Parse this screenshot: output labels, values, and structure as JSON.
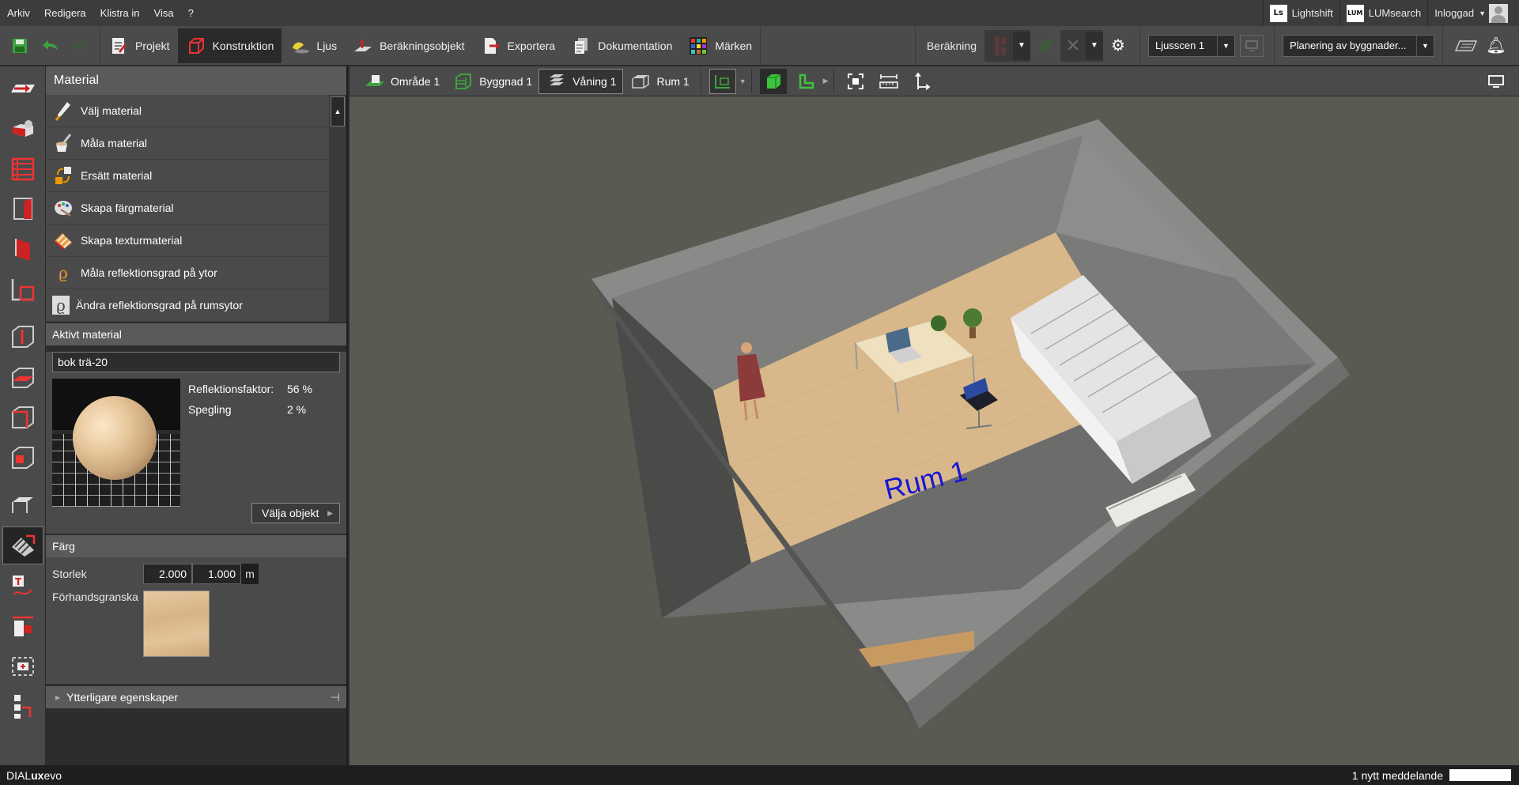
{
  "menu": [
    "Arkiv",
    "Redigera",
    "Klistra in",
    "Visa",
    "?"
  ],
  "topright": {
    "lightshift_logo": "Ls",
    "lightshift": "Lightshift",
    "lumsearch_logo": "LUM",
    "lumsearch": "LUMsearch",
    "user": "Inloggad"
  },
  "toolbar": {
    "tabs": [
      "Projekt",
      "Konstruktion",
      "Ljus",
      "Beräkningsobjekt",
      "Exportera",
      "Dokumentation",
      "Märken"
    ],
    "active_tab": "Konstruktion",
    "berakning": "Beräkning",
    "scene_select": "Ljusscen 1",
    "planning_select": "Planering av byggnader..."
  },
  "panel": {
    "title": "Material",
    "tools": [
      {
        "label": "Välj material",
        "icon": "pipette-icon"
      },
      {
        "label": "Måla material",
        "icon": "paint-bucket-icon"
      },
      {
        "label": "Ersätt material",
        "icon": "replace-icon"
      },
      {
        "label": "Skapa färgmaterial",
        "icon": "palette-icon"
      },
      {
        "label": "Skapa texturmaterial",
        "icon": "texture-icon"
      },
      {
        "label": "Måla reflektionsgrad på ytor",
        "icon": "rho-orange-icon"
      },
      {
        "label": "Ändra reflektionsgrad på rumsytor",
        "icon": "rho-gray-icon"
      }
    ],
    "active_material_title": "Aktivt material",
    "active_material_name": "bok trä-20",
    "reflection_label": "Reflektionsfaktor:",
    "reflection_value": "56 %",
    "specular_label": "Spegling",
    "specular_value": "2 %",
    "select_objects": "Välja objekt",
    "color_title": "Färg",
    "size_label": "Storlek",
    "size_w": "2.000",
    "size_h": "1.000",
    "size_unit": "m",
    "preview_label": "Förhandsgranska",
    "more_props": "Ytterligare egenskaper"
  },
  "viewbar": {
    "crumbs": [
      "Område 1",
      "Byggnad 1",
      "Våning 1",
      "Rum 1"
    ],
    "active_crumb": "Våning 1"
  },
  "scene": {
    "room_label": "Rum 1",
    "colors": {
      "floor": "#d8b88a",
      "wall": "#7a7a7a",
      "room_label": "#1616d8"
    }
  },
  "status": {
    "brand_prefix": "DIAL",
    "brand_bold": "ux",
    "brand_suffix": "evo",
    "message": "1 nytt meddelande"
  }
}
